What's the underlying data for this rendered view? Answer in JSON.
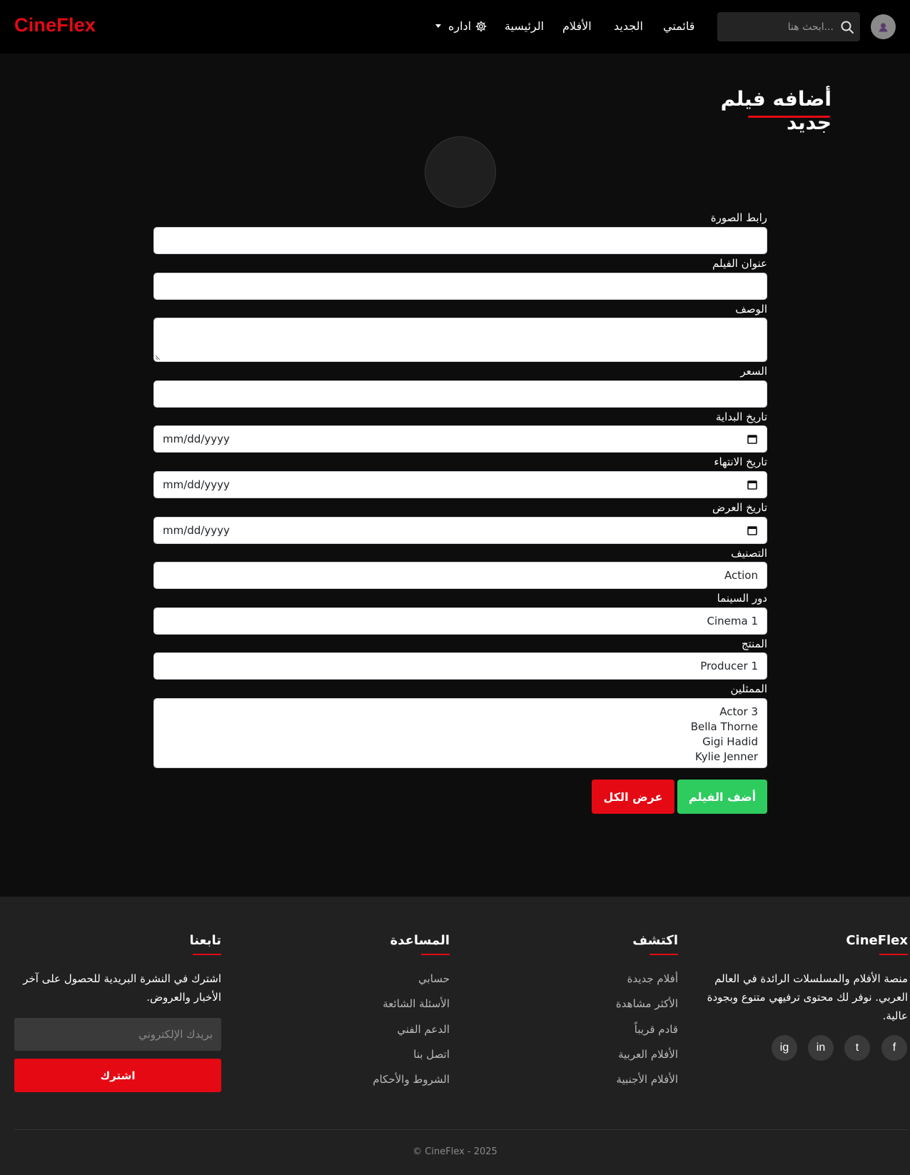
{
  "navbar": {
    "brand": "CineFlex",
    "items": [
      {
        "label": "قائمتي"
      },
      {
        "label": "الجديد"
      },
      {
        "label": "الأفلام"
      },
      {
        "label": "الرئيسية"
      },
      {
        "label": "اداره"
      }
    ],
    "search_placeholder": "...ابحث هنا"
  },
  "page": {
    "title": "أضافه فيلم جديد"
  },
  "form": {
    "image_url_label": "رابط الصورة",
    "title_label": "عنوان الفيلم",
    "description_label": "الوصف",
    "price_label": "السعر",
    "start_date_label": "تاريخ البداية",
    "start_date_value": "mm/dd/yyyy",
    "end_date_label": "تاريخ الانتهاء",
    "end_date_value": "mm/dd/yyyy",
    "show_date_label": "تاريخ العرض",
    "show_date_value": "mm/dd/yyyy",
    "category_label": "التصنيف",
    "category_value": "Action",
    "cinema_label": "دور السينما",
    "cinema_value": "Cinema 1",
    "producer_label": "المنتج",
    "producer_value": "Producer 1",
    "actors_label": "الممثلين",
    "actors_options": [
      "Actor 3",
      "Bella Thorne",
      "Gigi Hadid",
      "Kylie Jenner"
    ],
    "add_button": "أضف الفيلم",
    "view_all_button": "عرض الكل"
  },
  "footer": {
    "brand_heading": "CineFlex",
    "brand_text": "منصة الأفلام والمسلسلات الرائدة في العالم العربي. نوفر لك محتوى ترفيهي متنوع وبجودة عالية.",
    "social": [
      "f",
      "t",
      "in",
      "ig"
    ],
    "discover_heading": "اكتشف",
    "discover_links": [
      "أفلام جديدة",
      "الأكثر مشاهدة",
      "قادم قريباً",
      "الأفلام العربية",
      "الأفلام الأجنبية"
    ],
    "help_heading": "المساعدة",
    "help_links": [
      "حسابي",
      "الأسئلة الشائعة",
      "الدعم الفني",
      "اتصل بنا",
      "الشروط والأحكام"
    ],
    "follow_heading": "تابعنا",
    "follow_text": "اشترك في النشرة البريدية للحصول على آخر الأخبار والعروض.",
    "email_placeholder": "بريدك الإلكتروني",
    "subscribe_button": "اشترك",
    "copyright": "CineFlex - 2025 ©"
  },
  "colors": {
    "accent": "#e50914",
    "success": "#2ecc5f",
    "background": "#0d0d0d",
    "footer": "#212121"
  }
}
